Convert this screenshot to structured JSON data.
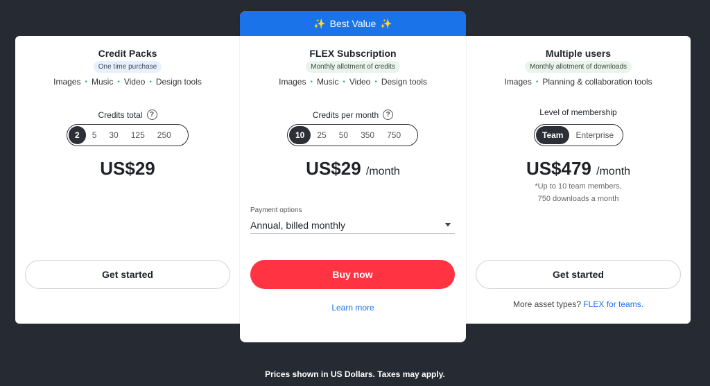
{
  "badge": {
    "label": "Best Value",
    "sparkle": "✨"
  },
  "plans": [
    {
      "title": "Credit Packs",
      "tag": "One time purchase",
      "features": [
        "Images",
        "Music",
        "Video",
        "Design tools"
      ],
      "selector_label": "Credits total",
      "options": [
        "2",
        "5",
        "30",
        "125",
        "250"
      ],
      "selected": "2",
      "price": "US$29",
      "cta": "Get started"
    },
    {
      "title": "FLEX Subscription",
      "tag": "Monthly allotment of credits",
      "features": [
        "Images",
        "Music",
        "Video",
        "Design tools"
      ],
      "selector_label": "Credits per month",
      "options": [
        "10",
        "25",
        "50",
        "350",
        "750"
      ],
      "selected": "10",
      "price": "US$29",
      "period": "/month",
      "payment_label": "Payment options",
      "payment_value": "Annual, billed monthly",
      "cta": "Buy now",
      "link": "Learn more"
    },
    {
      "title": "Multiple users",
      "tag": "Monthly allotment of downloads",
      "features": [
        "Images",
        "Planning & collaboration tools"
      ],
      "selector_label": "Level of membership",
      "options": [
        "Team",
        "Enterprise"
      ],
      "selected": "Team",
      "price": "US$479",
      "period": "/month",
      "note_line1": "*Up to 10 team members,",
      "note_line2": "750 downloads a month",
      "cta": "Get started",
      "footer_text": "More asset types?",
      "footer_link": "FLEX for teams."
    }
  ],
  "disclaimer": "Prices shown in US Dollars. Taxes may apply.",
  "help_glyph": "?",
  "colors": {
    "accent_blue": "#1a73e8",
    "cta_red": "#ff3341",
    "background": "#262a33",
    "selected_seg": "#2c2f36"
  }
}
